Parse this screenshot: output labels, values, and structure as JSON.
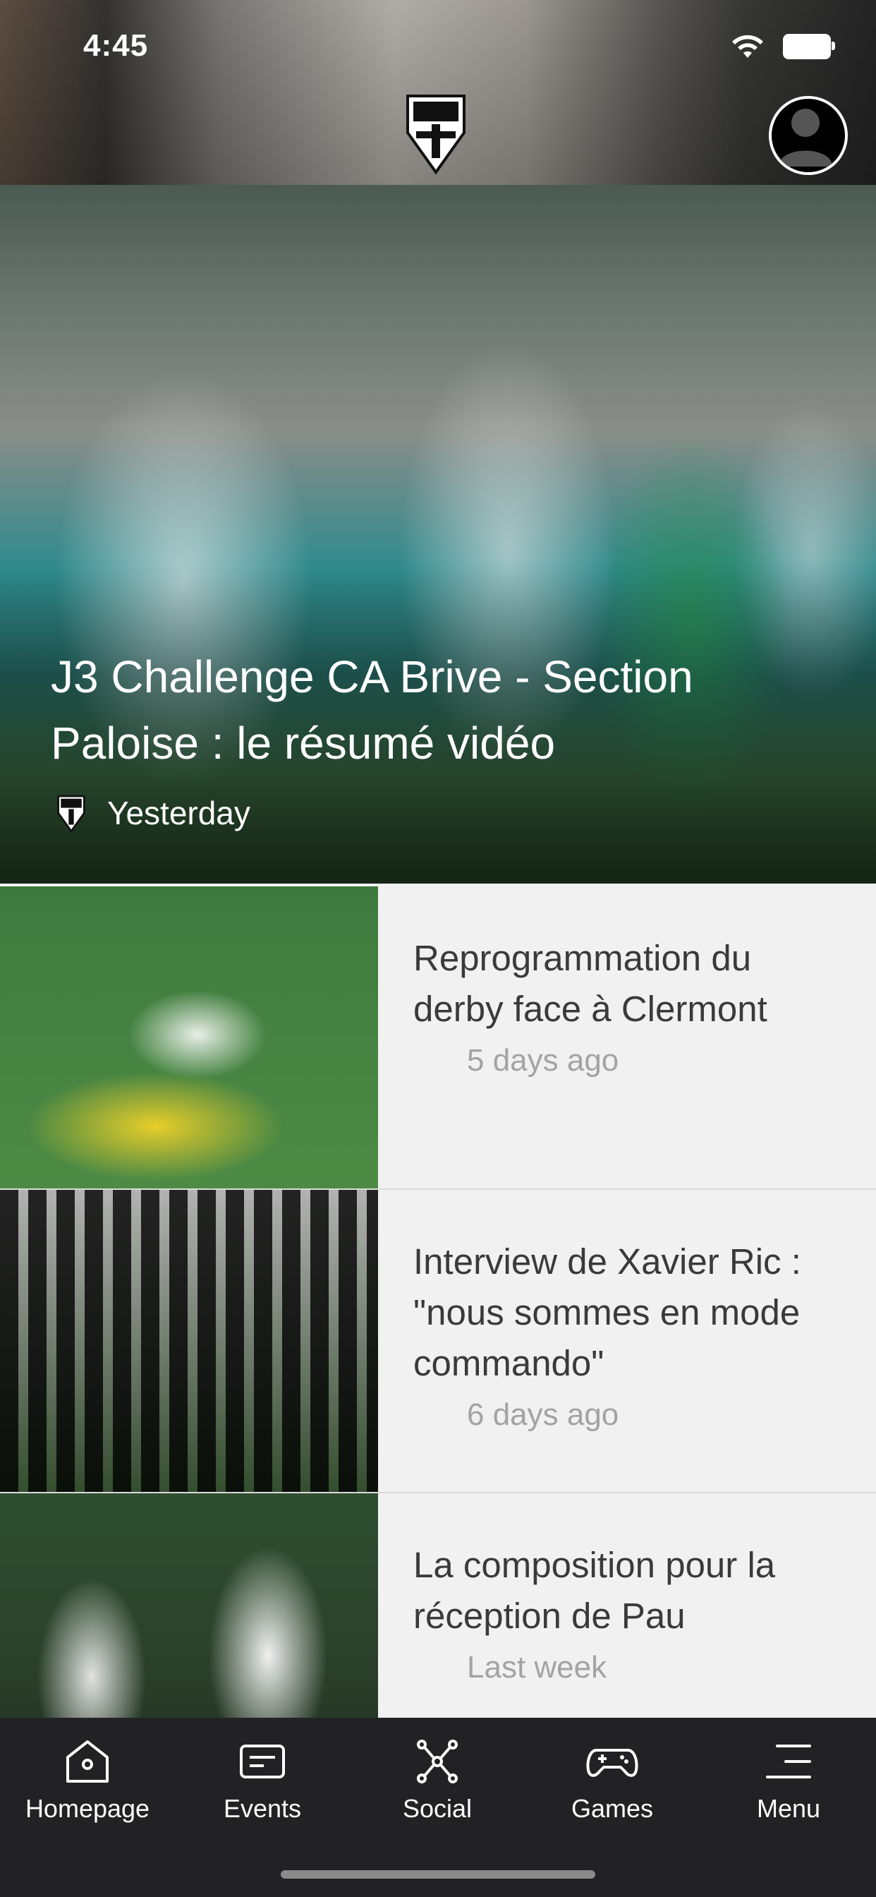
{
  "status_bar": {
    "time": "4:45"
  },
  "header": {
    "logo_label": "C.A. Brive Corrèze Limousin"
  },
  "hero": {
    "title": "J3 Challenge CA Brive - Section Paloise : le résumé vidéo",
    "date": "Yesterday"
  },
  "articles": [
    {
      "title": "Reprogrammation du derby face à Clermont",
      "date": "5 days ago"
    },
    {
      "title": "Interview de Xavier Ric : \"nous sommes en mode commando\"",
      "date": "6 days ago"
    },
    {
      "title": "La composition pour la réception de Pau",
      "date": "Last week"
    }
  ],
  "nav": [
    {
      "label": "Homepage",
      "icon": "home-icon"
    },
    {
      "label": "Events",
      "icon": "events-icon"
    },
    {
      "label": "Social",
      "icon": "social-icon"
    },
    {
      "label": "Games",
      "icon": "gamepad-icon"
    },
    {
      "label": "Menu",
      "icon": "menu-icon"
    }
  ]
}
